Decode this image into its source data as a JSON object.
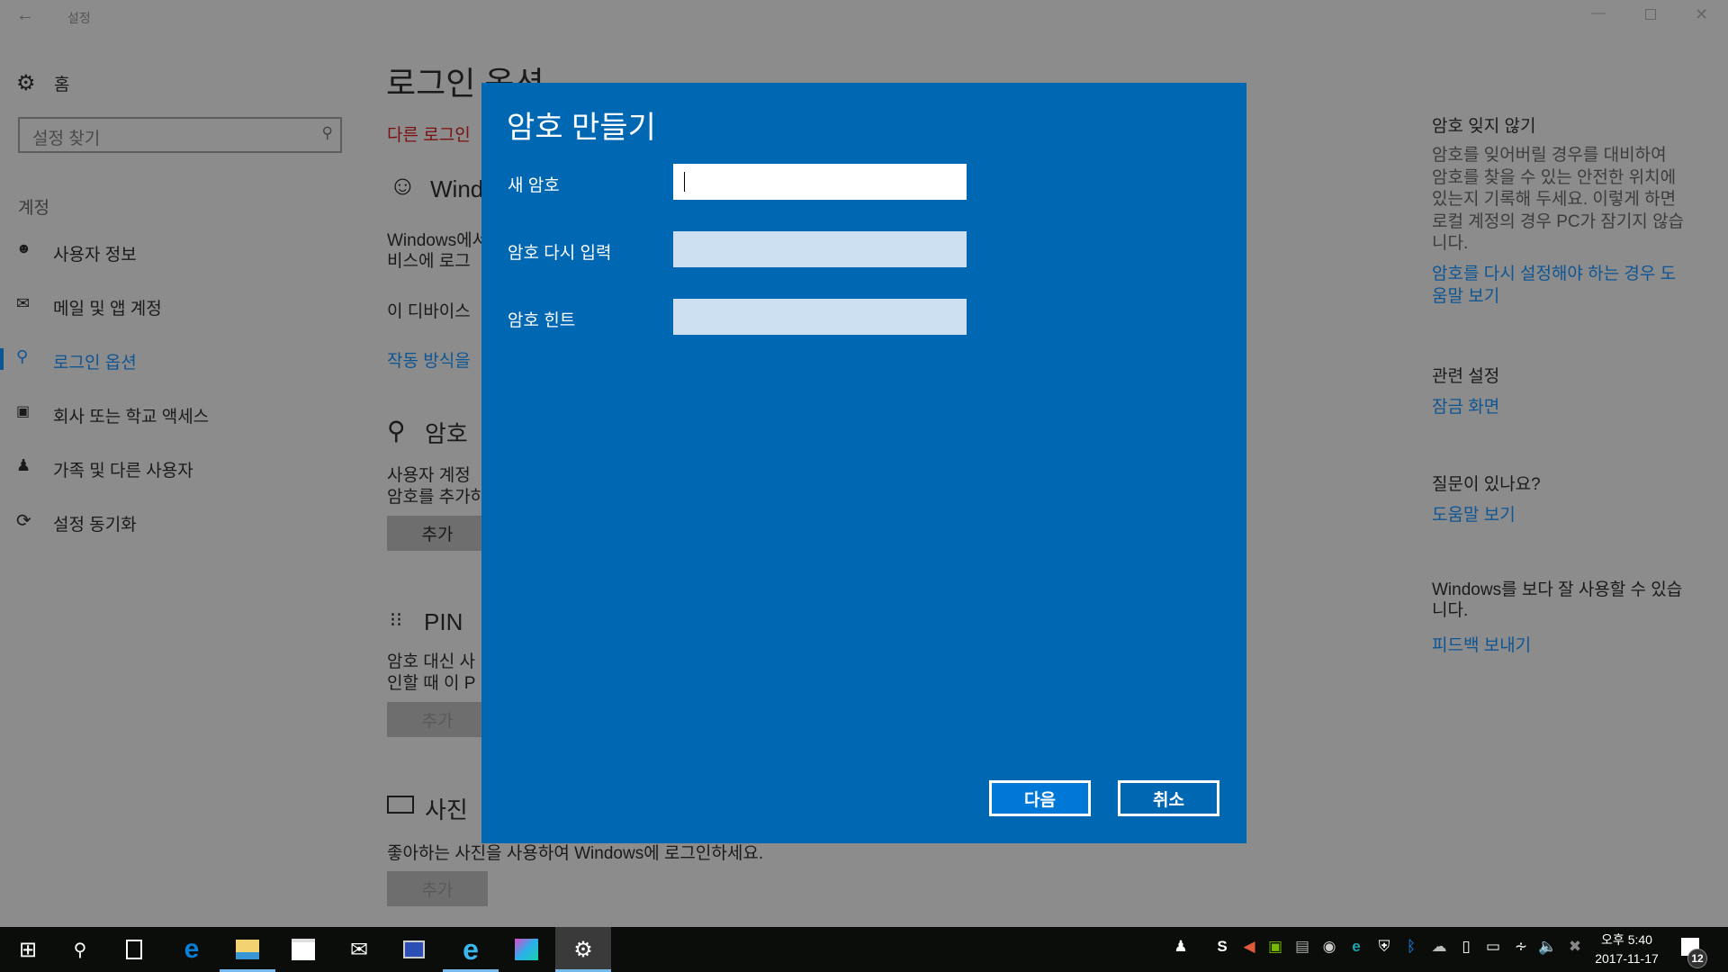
{
  "window": {
    "title": "설정"
  },
  "sidebar": {
    "home": "홈",
    "search_placeholder": "설정 찾기",
    "section": "계정",
    "items": [
      {
        "label": "사용자 정보",
        "icon": "user-info-icon"
      },
      {
        "label": "메일 및 앱 계정",
        "icon": "mail-icon"
      },
      {
        "label": "로그인 옵션",
        "icon": "key-icon",
        "active": true
      },
      {
        "label": "회사 또는 학교 액세스",
        "icon": "briefcase-icon"
      },
      {
        "label": "가족 및 다른 사용자",
        "icon": "person-icon"
      },
      {
        "label": "설정 동기화",
        "icon": "sync-icon"
      }
    ]
  },
  "main": {
    "title": "로그인 옵션",
    "warning": "다른 로그인",
    "hello": {
      "title": "Wind",
      "line1": "Windows에서",
      "line2": "비스에 로그",
      "line3": "이 디바이스",
      "link": "작동 방식을"
    },
    "password": {
      "title": "암호",
      "line1": "사용자 계정",
      "line2": "암호를 추가하",
      "button": "추가"
    },
    "pin": {
      "title": "PIN",
      "line1": "암호 대신 사",
      "line2": "인할 때 이 P",
      "button": "추가"
    },
    "picture": {
      "title": "사진",
      "desc": "좋아하는 사진을 사용하여 Windows에 로그인하세요.",
      "button": "추가"
    }
  },
  "right": {
    "h1": "암호 잊지 않기",
    "p1": [
      "암호를 잊어버릴 경우를 대비하여",
      "암호를 찾을 수 있는 안전한 위치에",
      "있는지 기록해 두세요. 이렇게 하면",
      "로컬 계정의 경우 PC가 잠기지 않습",
      "니다."
    ],
    "link1": [
      "암호를 다시 설정해야 하는 경우 도",
      "움말 보기"
    ],
    "h2": "관련 설정",
    "link2": "잠금 화면",
    "h3": "질문이 있나요?",
    "link3": "도움말 보기",
    "h4": [
      "Windows를 보다 잘 사용할 수 있습",
      "니다."
    ],
    "link4": "피드백 보내기"
  },
  "dialog": {
    "title": "암호 만들기",
    "fields": [
      {
        "label": "새 암호",
        "value": ""
      },
      {
        "label": "암호 다시 입력",
        "value": ""
      },
      {
        "label": "암호 힌트",
        "value": ""
      }
    ],
    "next": "다음",
    "cancel": "취소"
  },
  "taskbar": {
    "time": "오후 5:40",
    "date": "2017-11-17",
    "notifications": "12"
  },
  "colors": {
    "dialog": "#0067b3",
    "accent": "#0078d7",
    "overlay": "#8c8c8c",
    "warning": "#7a1010"
  }
}
